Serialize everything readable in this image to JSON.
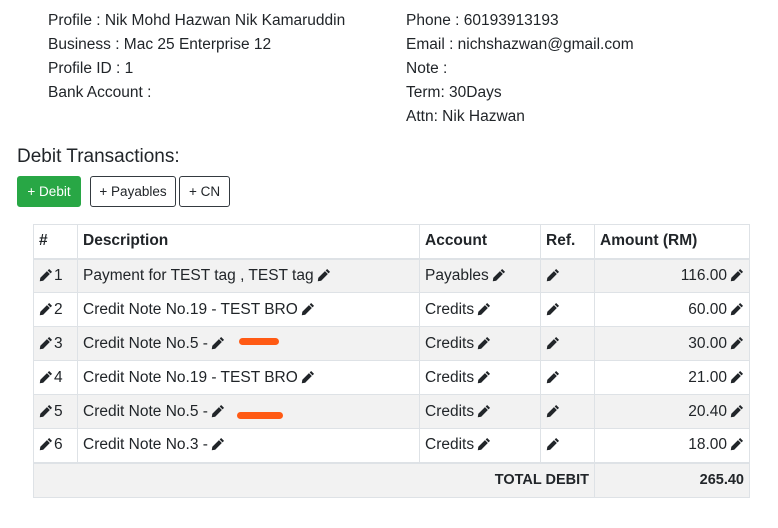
{
  "profile": {
    "profile": "Profile : Nik Mohd Hazwan Nik Kamaruddin",
    "business": "Business : Mac 25 Enterprise 12",
    "profile_id": "Profile ID : 1",
    "bank_account": "Bank Account :",
    "phone": "Phone : 60193913193",
    "email": "Email : nichshazwan@gmail.com",
    "note": "Note :",
    "term": "Term: 30Days",
    "attn": "Attn: Nik Hazwan"
  },
  "section": {
    "title": "Debit Transactions:"
  },
  "buttons": {
    "debit": "+ Debit",
    "payables": "+ Payables",
    "cn": "+ CN"
  },
  "table": {
    "headers": [
      "#",
      "Description",
      "Account",
      "Ref.",
      "Amount (RM)"
    ],
    "rows": [
      {
        "no": "1",
        "description": "Payment for TEST tag , TEST tag",
        "account": "Payables",
        "amount": "116.00"
      },
      {
        "no": "2",
        "description": "Credit Note No.19 - TEST BRO",
        "account": "Credits",
        "amount": "60.00"
      },
      {
        "no": "3",
        "description": "Credit Note No.5 -",
        "account": "Credits",
        "amount": "30.00"
      },
      {
        "no": "4",
        "description": "Credit Note No.19 - TEST BRO",
        "account": "Credits",
        "amount": "21.00"
      },
      {
        "no": "5",
        "description": "Credit Note No.5 -",
        "account": "Credits",
        "amount": "20.40"
      },
      {
        "no": "6",
        "description": "Credit Note No.3 -",
        "account": "Credits",
        "amount": "18.00"
      }
    ],
    "total_label": "TOTAL DEBIT",
    "total_value": "265.40"
  },
  "icons": {
    "edit": "pencil-icon",
    "redaction": "redaction-mark"
  },
  "colors": {
    "success": "#28a745",
    "redaction": "#ff5a14",
    "stripe": "#f2f2f2"
  }
}
